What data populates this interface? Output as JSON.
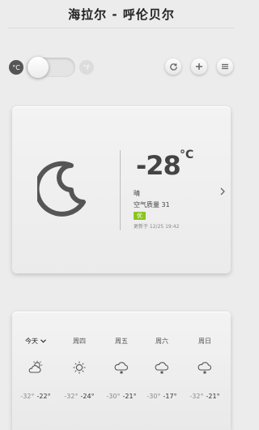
{
  "header": {
    "title": "海拉尔 - 呼伦贝尔"
  },
  "unit_toggle": {
    "celsius_label": "°C",
    "fahrenheit_label": "°F",
    "selected": "celsius"
  },
  "toolbar": {
    "icons": [
      "refresh-icon",
      "add-icon",
      "menu-icon"
    ]
  },
  "current": {
    "temperature": "-28",
    "unit": "°C",
    "condition": "晴",
    "aqi_text": "空气质量 31",
    "aqi_level": "优",
    "updated": "更新于 12/25 19:42",
    "icon": "moon-icon",
    "aqi_color": "#8bc51f"
  },
  "forecast": [
    {
      "label": "今天",
      "low": "-32°",
      "high": "-22°",
      "icon": "partly-cloudy-icon"
    },
    {
      "label": "周四",
      "low": "-32°",
      "high": "-24°",
      "icon": "sun-icon"
    },
    {
      "label": "周五",
      "low": "-30°",
      "high": "-21°",
      "icon": "snow-icon"
    },
    {
      "label": "周六",
      "low": "-30°",
      "high": "-17°",
      "icon": "snow-icon"
    },
    {
      "label": "周日",
      "low": "-32°",
      "high": "-21°",
      "icon": "snow-icon"
    }
  ]
}
